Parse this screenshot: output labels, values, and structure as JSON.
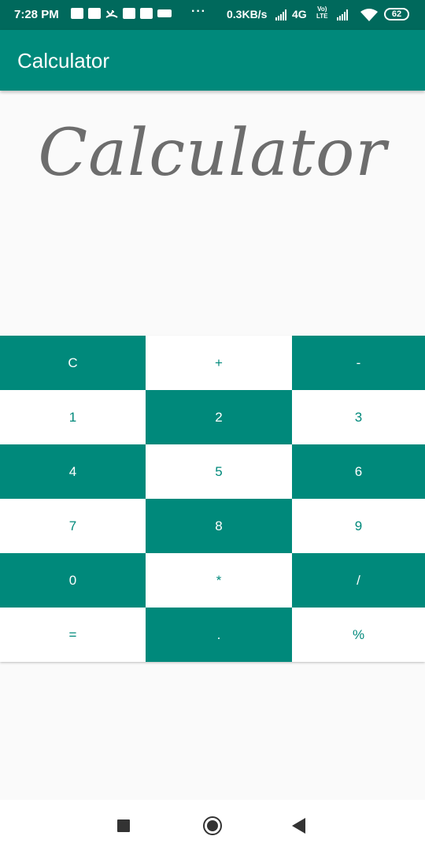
{
  "status_bar": {
    "time": "7:28 PM",
    "more": "···",
    "net_speed": "0.3KB/s",
    "network_type": "4G",
    "volte_top": "Vo)",
    "volte_bottom": "LTE",
    "battery": "62",
    "icons": [
      "notification-icon",
      "message-icon",
      "missed-call-icon",
      "train-icon",
      "gmail-icon",
      "app-icon"
    ]
  },
  "app_bar": {
    "title": "Calculator"
  },
  "logo": {
    "text": "Calculator"
  },
  "keypad": {
    "keys": [
      {
        "label": "C",
        "name": "clear-button",
        "style": "teal"
      },
      {
        "label": "+",
        "name": "plus-button",
        "style": "white"
      },
      {
        "label": "-",
        "name": "minus-button",
        "style": "teal"
      },
      {
        "label": "1",
        "name": "digit-1-button",
        "style": "white"
      },
      {
        "label": "2",
        "name": "digit-2-button",
        "style": "teal"
      },
      {
        "label": "3",
        "name": "digit-3-button",
        "style": "white"
      },
      {
        "label": "4",
        "name": "digit-4-button",
        "style": "teal"
      },
      {
        "label": "5",
        "name": "digit-5-button",
        "style": "white"
      },
      {
        "label": "6",
        "name": "digit-6-button",
        "style": "teal"
      },
      {
        "label": "7",
        "name": "digit-7-button",
        "style": "white"
      },
      {
        "label": "8",
        "name": "digit-8-button",
        "style": "teal"
      },
      {
        "label": "9",
        "name": "digit-9-button",
        "style": "white"
      },
      {
        "label": "0",
        "name": "digit-0-button",
        "style": "teal"
      },
      {
        "label": "*",
        "name": "multiply-button",
        "style": "white"
      },
      {
        "label": "/",
        "name": "divide-button",
        "style": "teal"
      },
      {
        "label": "=",
        "name": "equals-button",
        "style": "white"
      },
      {
        "label": ".",
        "name": "decimal-button",
        "style": "teal"
      },
      {
        "label": "%",
        "name": "percent-button",
        "style": "white"
      }
    ]
  },
  "nav_bar": {
    "icons": [
      "recent-apps-icon",
      "home-icon",
      "back-icon"
    ]
  },
  "colors": {
    "status_bar": "#00695c",
    "primary": "#00897b",
    "background": "#fafafa",
    "logo_text": "#6d6d6d"
  }
}
